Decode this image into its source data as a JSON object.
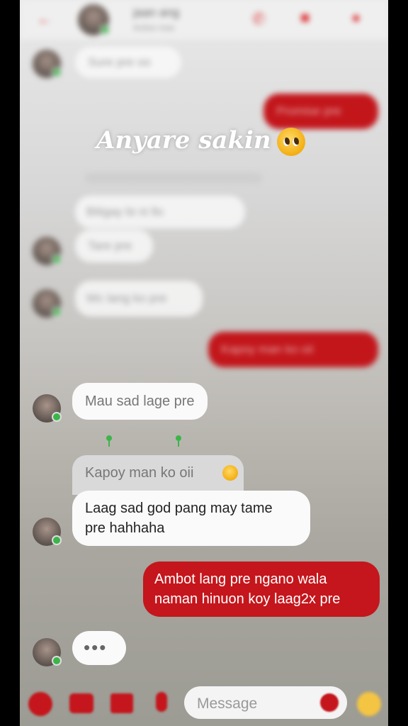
{
  "header": {
    "contact_name": "jaan ang",
    "status": "Active now"
  },
  "overlay": {
    "caption": "Anyare sakin"
  },
  "blurred_messages": {
    "incoming_1": "Sure pre oo",
    "outgoing_1": "Promise pre",
    "timestamp": "",
    "incoming_2": "Bitigay bi ni llo",
    "incoming_3": "Tare pre",
    "incoming_4": "Wc lang ko pre",
    "outgoing_2": "Kapoy man ko oii"
  },
  "messages": {
    "incoming_mau": "Mau sad lage pre",
    "reply_preview": "Kapoy man ko oii",
    "incoming_laag_line1": "Laag sad god pang may tame",
    "incoming_laag_line2": "pre hahhaha",
    "outgoing_ambot_line1": "Ambot lang pre ngano wala",
    "outgoing_ambot_line2": "naman hinuon koy laag2x pre",
    "typing": "•••"
  },
  "composer": {
    "placeholder": "Message"
  },
  "icons": {
    "back": "back-arrow-icon",
    "call": "phone-icon",
    "video": "video-camera-icon",
    "info": "info-icon",
    "apps": "menu-dots-icon",
    "camera": "camera-icon",
    "gallery": "image-icon",
    "mic": "microphone-icon",
    "emoji": "emoji-icon",
    "like": "thumbs-up-icon"
  },
  "colors": {
    "accent": "#c4161c",
    "bubble_in": "#fafafa",
    "online": "#3bb54a"
  }
}
